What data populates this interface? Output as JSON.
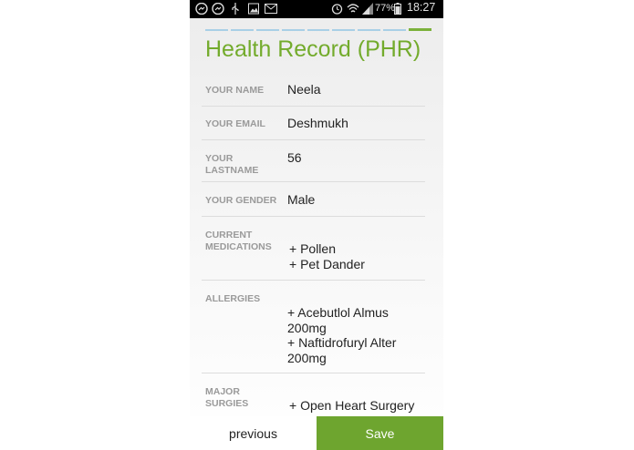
{
  "status_bar": {
    "battery": "77%",
    "time": "18:27",
    "icons": [
      "messenger-icon",
      "messenger-icon",
      "usb-icon",
      "image-icon",
      "gmail-icon",
      "alarm-icon",
      "wifi-icon",
      "signal-icon",
      "battery-icon"
    ]
  },
  "progress": {
    "steps": 9,
    "current": 9
  },
  "page": {
    "title": "Health Record (PHR)"
  },
  "fields": [
    {
      "label": "YOUR NAME",
      "value": "Neela"
    },
    {
      "label": "YOUR EMAIL",
      "value": "Deshmukh"
    },
    {
      "label": "YOUR LASTNAME",
      "value": "56"
    },
    {
      "label": "YOUR GENDER",
      "value": "Male"
    },
    {
      "label": "CURRENT MEDICATIONS",
      "value": "+ Pollen\n+ Pet Dander"
    },
    {
      "label": "ALLERGIES",
      "value": "+ Acebutlol Almus 200mg\n+ Naftidrofuryl Alter 200mg"
    },
    {
      "label": "MAJOR SURGIES",
      "value": "+ Open Heart Surgery"
    }
  ],
  "buttons": {
    "previous": "previous",
    "save": "Save"
  },
  "colors": {
    "accent": "#73ab2c",
    "save_bg": "#6ea52f",
    "progress_inactive": "#a9cfe6"
  }
}
